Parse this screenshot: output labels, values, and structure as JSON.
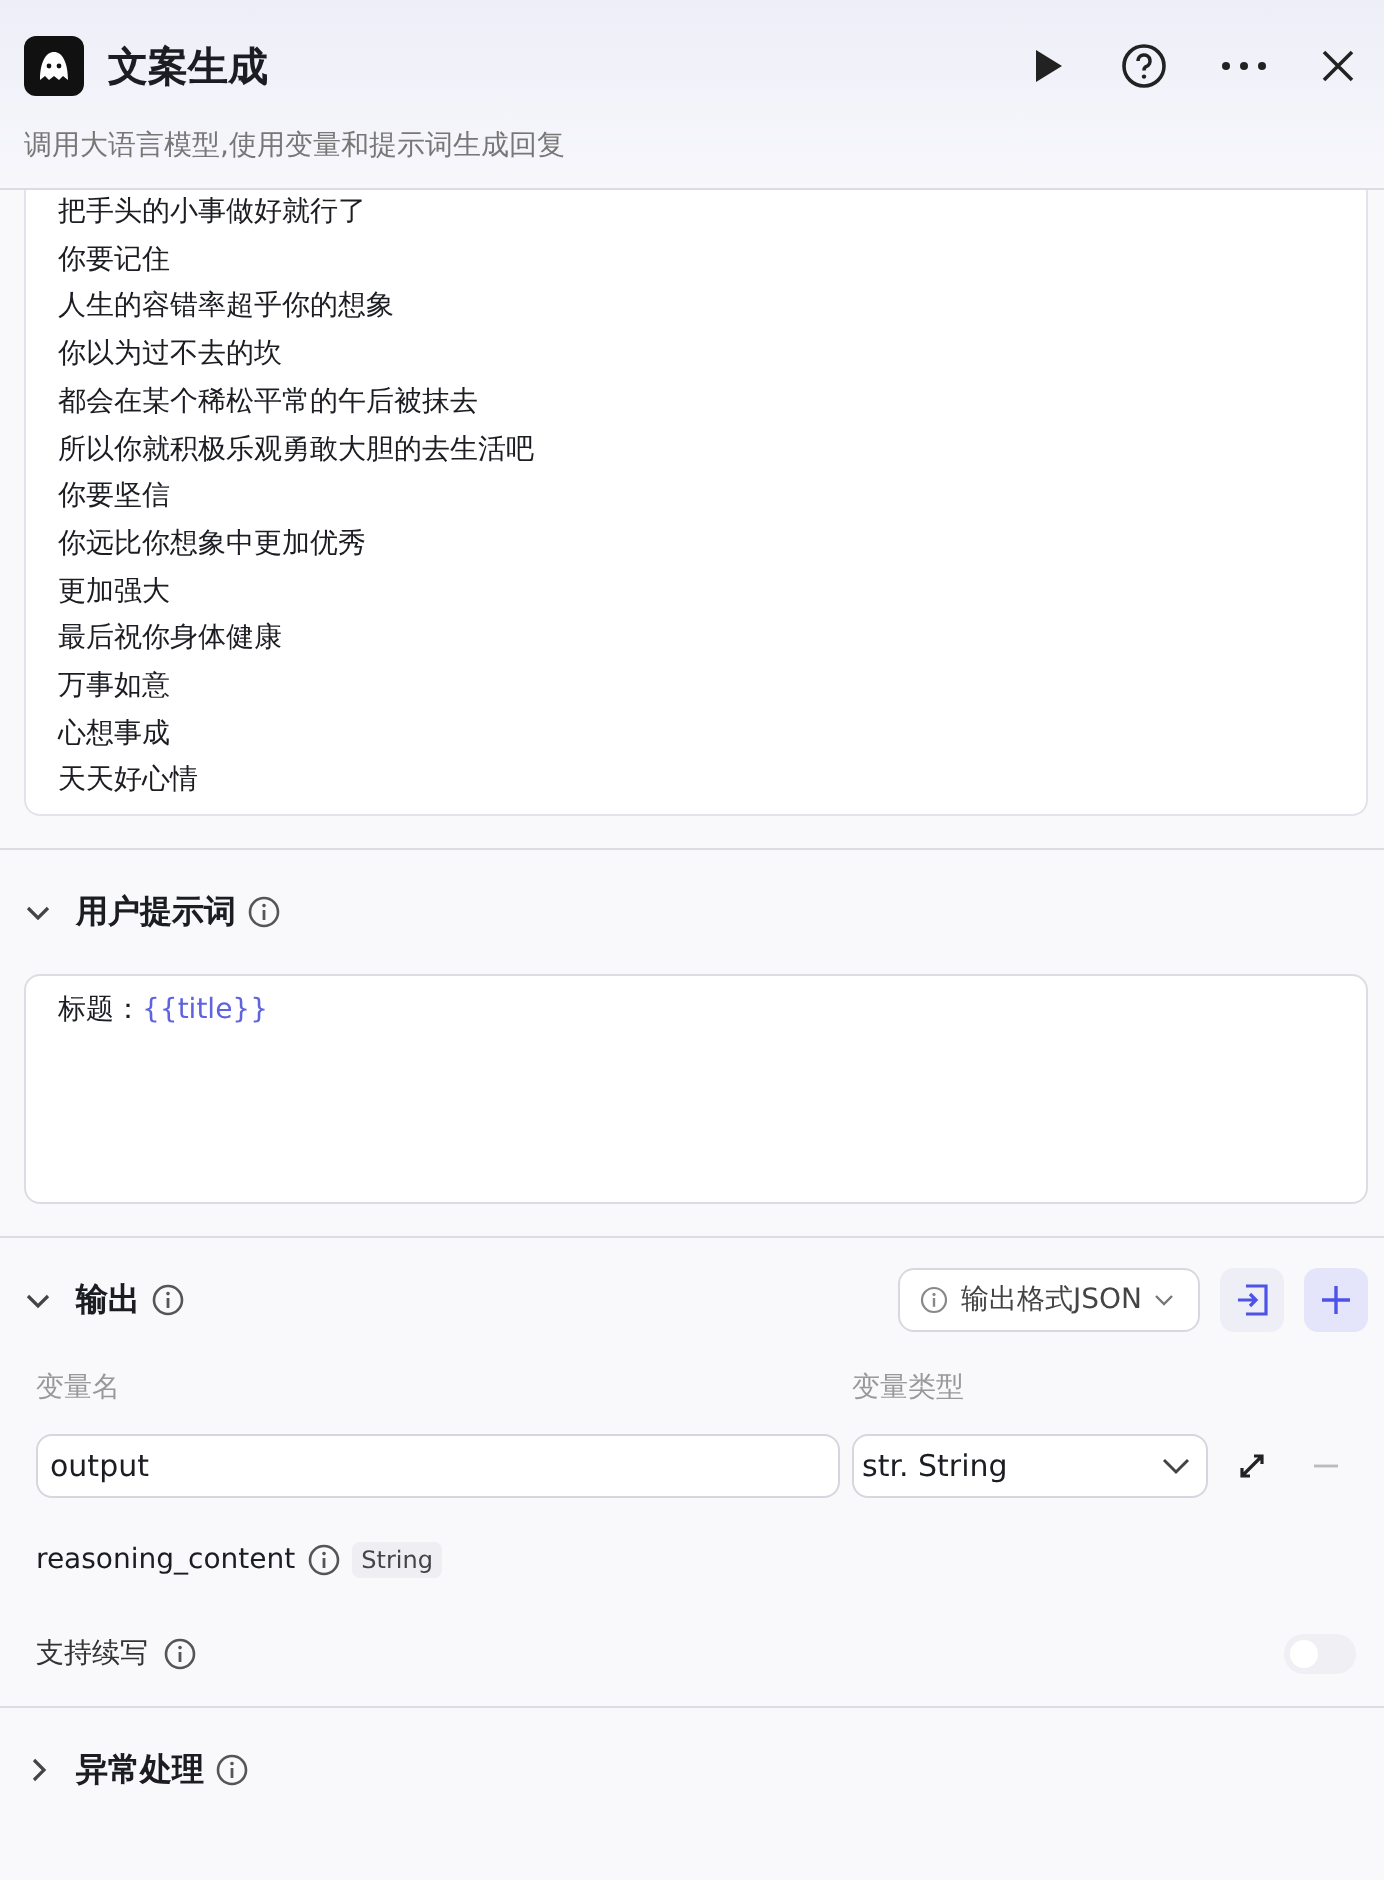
{
  "header": {
    "title": "文案生成",
    "description": "调用大语言模型,使用变量和提示词生成回复"
  },
  "system_prompt": {
    "lines": [
      "把手头的小事做好就行了",
      "你要记住",
      "人生的容错率超乎你的想象",
      "你以为过不去的坎",
      "都会在某个稀松平常的午后被抹去",
      "所以你就积极乐观勇敢大胆的去生活吧",
      "你要坚信",
      "你远比你想象中更加优秀",
      "更加强大",
      "最后祝你身体健康",
      "万事如意",
      "心想事成",
      "天天好心情"
    ]
  },
  "user_prompt": {
    "title": "用户提示词",
    "expanded": true,
    "label": "标题：",
    "variable": "{{title}}"
  },
  "output": {
    "title": "输出",
    "expanded": true,
    "format_button": "输出格式JSON",
    "col_name": "变量名",
    "col_type": "变量类型",
    "rows": [
      {
        "name": "output",
        "type": "str. String"
      }
    ],
    "reasoning": {
      "name": "reasoning_content",
      "type": "String"
    },
    "continue": {
      "label": "支持续写",
      "on": false
    }
  },
  "exception": {
    "title": "异常处理",
    "expanded": false
  }
}
